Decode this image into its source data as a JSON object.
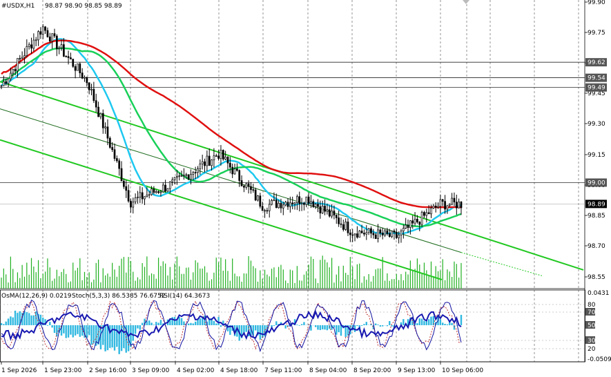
{
  "symbol_title": "#USDX,H1",
  "ohlc": "98.87 98.90 98.85 98.89",
  "indicators": {
    "osma": "OsMA(12,26,9) 0.0219",
    "stoch": "Stoch(5,3,3) 86.5385 76.6752",
    "rsi": "RSI(14) 64.3673"
  },
  "colors": {
    "candle": "#000000",
    "ma_fast": "#1ec8f0",
    "ma_mid": "#18d058",
    "ma_slow": "#e01010",
    "channel": "#20c820",
    "volume": "#20b020",
    "osma": "#30b8e0",
    "stoch_main": "#1010a0",
    "stoch_signal": "#c03030",
    "rsi": "#1818b0",
    "tag_bg": "#555555",
    "grid": "#000000"
  },
  "price_axis": [
    "99.90",
    "99.75",
    "99.60",
    "99.45",
    "99.30",
    "99.15",
    "99.00",
    "98.85",
    "98.70",
    "98.55"
  ],
  "price_tags": [
    "99.62",
    "99.54",
    "99.49",
    "99.00",
    "98.89"
  ],
  "indicator_axis": [
    "0.0431",
    "80",
    "70",
    "50",
    "30",
    "20",
    "-0.0509"
  ],
  "time_axis": [
    "1 Sep 2026",
    "1 Sep 23:00",
    "2 Sep 16:00",
    "3 Sep 09:00",
    "4 Sep 02:00",
    "4 Sep 18:00",
    "7 Sep 11:00",
    "8 Sep 04:00",
    "8 Sep 20:00",
    "9 Sep 13:00",
    "10 Sep 06:00"
  ],
  "chart_data": {
    "type": "candlestick",
    "title": "#USDX,H1",
    "ylim": [
      98.5,
      99.93
    ],
    "horizontal_levels": [
      99.62,
      99.54,
      99.49,
      99.0
    ],
    "last_price": 98.89,
    "close_path": [
      {
        "x": "1 Sep 2026",
        "y": 99.5
      },
      {
        "x": "1 Sep 23:00",
        "y": 99.8
      },
      {
        "x": "2 Sep 16:00",
        "y": 99.52
      },
      {
        "x": "3 Sep 09:00",
        "y": 98.9
      },
      {
        "x": "4 Sep 02:00",
        "y": 99.0
      },
      {
        "x": "4 Sep 18:00",
        "y": 99.15
      },
      {
        "x": "7 Sep 11:00",
        "y": 98.88
      },
      {
        "x": "8 Sep 04:00",
        "y": 98.92
      },
      {
        "x": "8 Sep 20:00",
        "y": 98.75
      },
      {
        "x": "9 Sep 13:00",
        "y": 98.72
      },
      {
        "x": "10 Sep 06:00",
        "y": 98.89
      }
    ]
  }
}
